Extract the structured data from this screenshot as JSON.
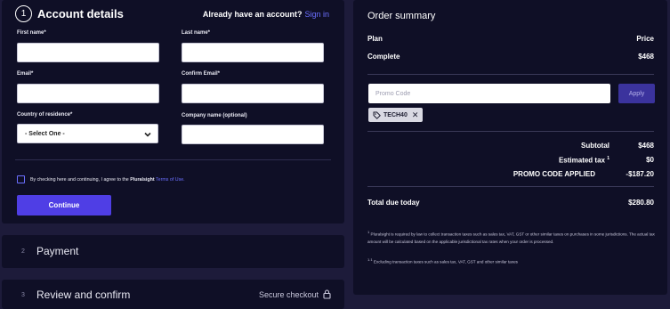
{
  "account": {
    "step_number": "1",
    "title": "Account details",
    "have_account_text": "Already have an account?",
    "sign_in_link": "Sign in",
    "first_name_label": "First name*",
    "last_name_label": "Last name*",
    "email_label": "Email*",
    "confirm_email_label": "Confirm Email*",
    "country_label": "Country of residence*",
    "country_selected": "- Select One -",
    "company_label": "Company name (optional)",
    "terms_prefix": "By checking here and continuing, I agree to the",
    "terms_brand": "Pluralsight",
    "terms_link": "Terms of Use.",
    "continue_label": "Continue"
  },
  "payment": {
    "step_number": "2",
    "title": "Payment"
  },
  "review": {
    "step_number": "3",
    "title": "Review and confirm",
    "secure_text": "Secure checkout"
  },
  "summary": {
    "title": "Order summary",
    "plan_header": "Plan",
    "price_header": "Price",
    "plan_name": "Complete",
    "plan_price": "$468",
    "promo_placeholder": "Promo Code",
    "apply_label": "Apply",
    "promo_chip": "TECH40",
    "subtotal_label": "Subtotal",
    "subtotal_value": "$468",
    "tax_label": "Estimated tax",
    "tax_sup": "1",
    "tax_value": "$0",
    "promo_applied_label": "PROMO CODE APPLIED",
    "promo_applied_value": "-$187.20",
    "total_label": "Total due today",
    "total_value": "$280.80",
    "footnote1_mark": "1",
    "footnote1": "Pluralsight is required by law to collect transaction taxes such as sales tax, VAT, GST or other similar taxes on purchases in some jurisdictions. The actual tax amount will be calculated based on the applicable jurisdictional tax rates when your order is processed.",
    "footnote2_mark": "1.1",
    "footnote2": "Excluding transaction taxes such as sales tax, VAT, GST and other similar taxes"
  },
  "colors": {
    "background": "#1d1b3a",
    "card": "#0f0f26",
    "accent": "#4f3ee5",
    "link": "#6b6fff"
  }
}
